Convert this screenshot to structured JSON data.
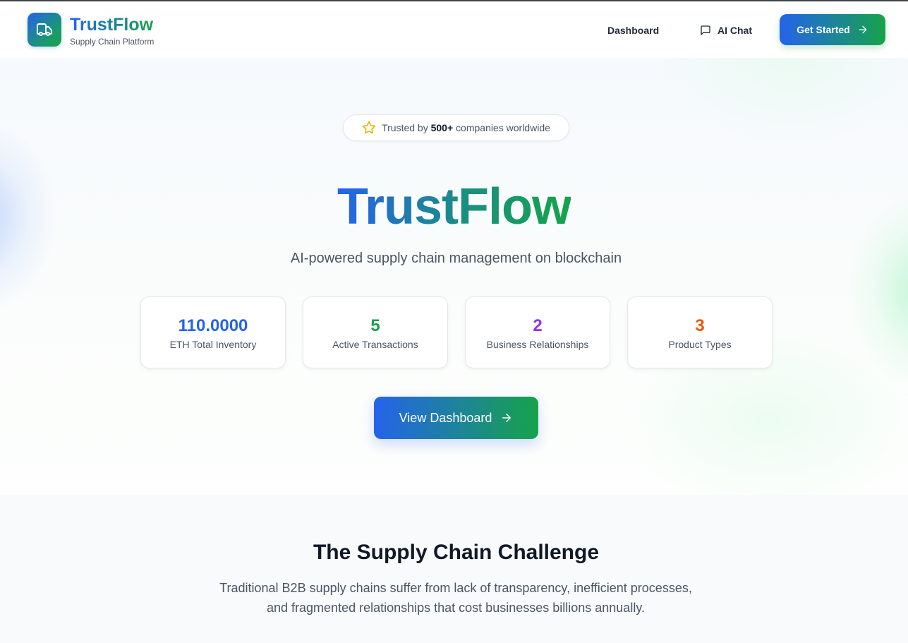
{
  "header": {
    "brand_title": "TrustFlow",
    "brand_subtitle": "Supply Chain Platform",
    "nav_dashboard": "Dashboard",
    "nav_ai_chat": "AI Chat",
    "get_started": "Get Started"
  },
  "hero": {
    "badge_prefix": "Trusted by",
    "badge_highlight": "500+",
    "badge_suffix": "companies worldwide",
    "title": "TrustFlow",
    "subtitle": "AI-powered supply chain management on blockchain",
    "stats": [
      {
        "value": "110.0000",
        "label": "ETH Total Inventory",
        "color": "#2563eb"
      },
      {
        "value": "5",
        "label": "Active Transactions",
        "color": "#16a34a"
      },
      {
        "value": "2",
        "label": "Business Relationships",
        "color": "#9333ea"
      },
      {
        "value": "3",
        "label": "Product Types",
        "color": "#ea580c"
      }
    ],
    "cta": "View Dashboard"
  },
  "challenge": {
    "title": "The Supply Chain Challenge",
    "text": "Traditional B2B supply chains suffer from lack of transparency, inefficient processes, and fragmented relationships that cost businesses billions annually."
  },
  "icons": {
    "logo": "truck-icon",
    "chat": "message-square-icon",
    "arrow": "arrow-right-icon",
    "badge": "star-icon"
  },
  "colors": {
    "brand_blue": "#2563eb",
    "brand_green": "#16a34a"
  }
}
